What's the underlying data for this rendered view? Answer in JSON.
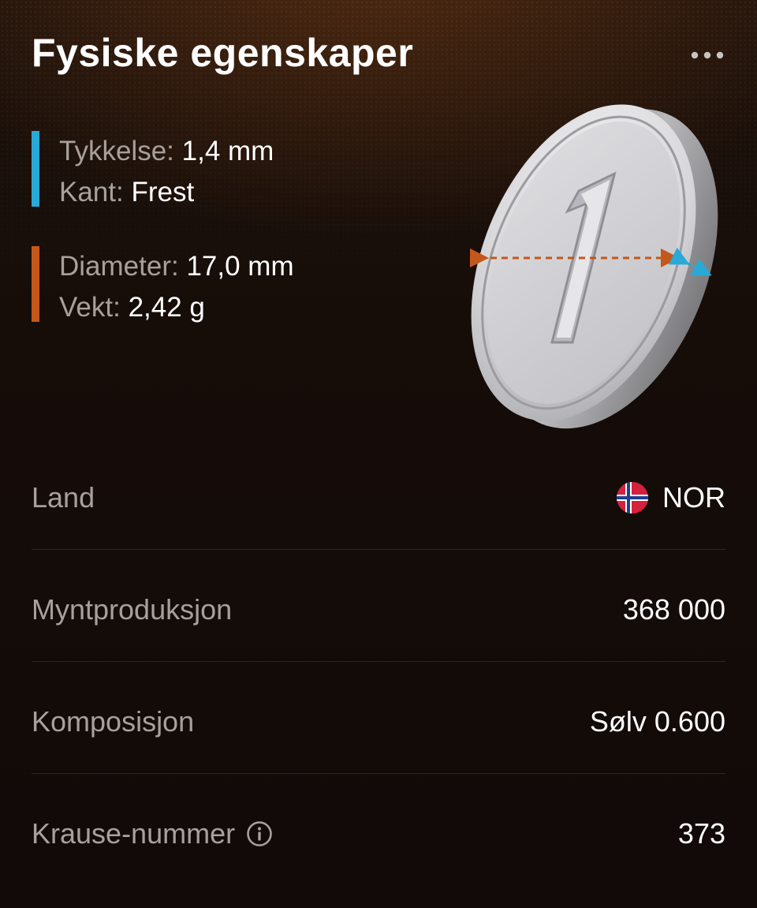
{
  "header": {
    "title": "Fysiske egenskaper",
    "more_icon": "ellipsis-icon"
  },
  "specs": {
    "group1": {
      "color": "#29a9d6",
      "thickness_label": "Tykkelse:",
      "thickness_value": "1,4 mm",
      "edge_label": "Kant:",
      "edge_value": "Frest"
    },
    "group2": {
      "color": "#c4571a",
      "diameter_label": "Diameter:",
      "diameter_value": "17,0 mm",
      "weight_label": "Vekt:",
      "weight_value": "2,42 g"
    }
  },
  "coin": {
    "face_number": "1",
    "icon": "coin-illustration"
  },
  "details": [
    {
      "label": "Land",
      "value": "NOR",
      "icon": "norway-flag-icon"
    },
    {
      "label": "Myntproduksjon",
      "value": "368 000"
    },
    {
      "label": "Komposisjon",
      "value": "Sølv 0.600"
    },
    {
      "label": "Krause-nummer",
      "value": "373",
      "info_icon": "info-icon"
    }
  ]
}
